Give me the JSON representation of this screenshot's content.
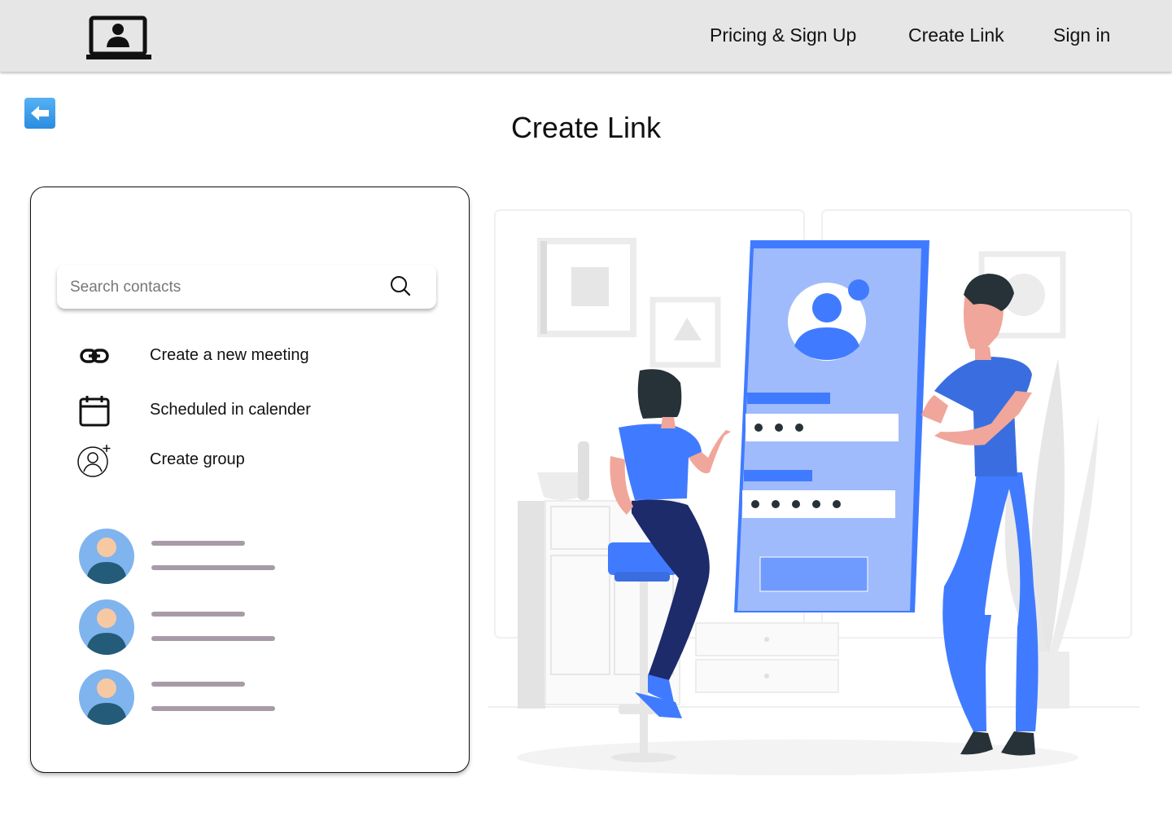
{
  "header": {
    "logo_icon": "laptop-user-icon",
    "nav": [
      {
        "label": "Pricing & Sign Up"
      },
      {
        "label": "Create Link"
      },
      {
        "label": "Sign in"
      }
    ]
  },
  "back_button": {
    "icon": "arrow-left-icon",
    "color": "#2a8de0"
  },
  "page": {
    "title": "Create Link"
  },
  "panel": {
    "search": {
      "placeholder": "Search contacts",
      "icon": "search-icon"
    },
    "menu": [
      {
        "label": "Create a new meeting",
        "icon": "link-icon"
      },
      {
        "label": "Scheduled in calender",
        "icon": "calendar-icon"
      },
      {
        "label": "Create group",
        "icon": "add-user-icon"
      }
    ],
    "contacts_count_visible": 3
  },
  "colors": {
    "accent_blue": "#407bff",
    "light_blue": "#a0bbfb",
    "navy": "#1d2b6b",
    "placeholder_line": "#a89ba8",
    "header_bg": "#e6e6e6"
  }
}
